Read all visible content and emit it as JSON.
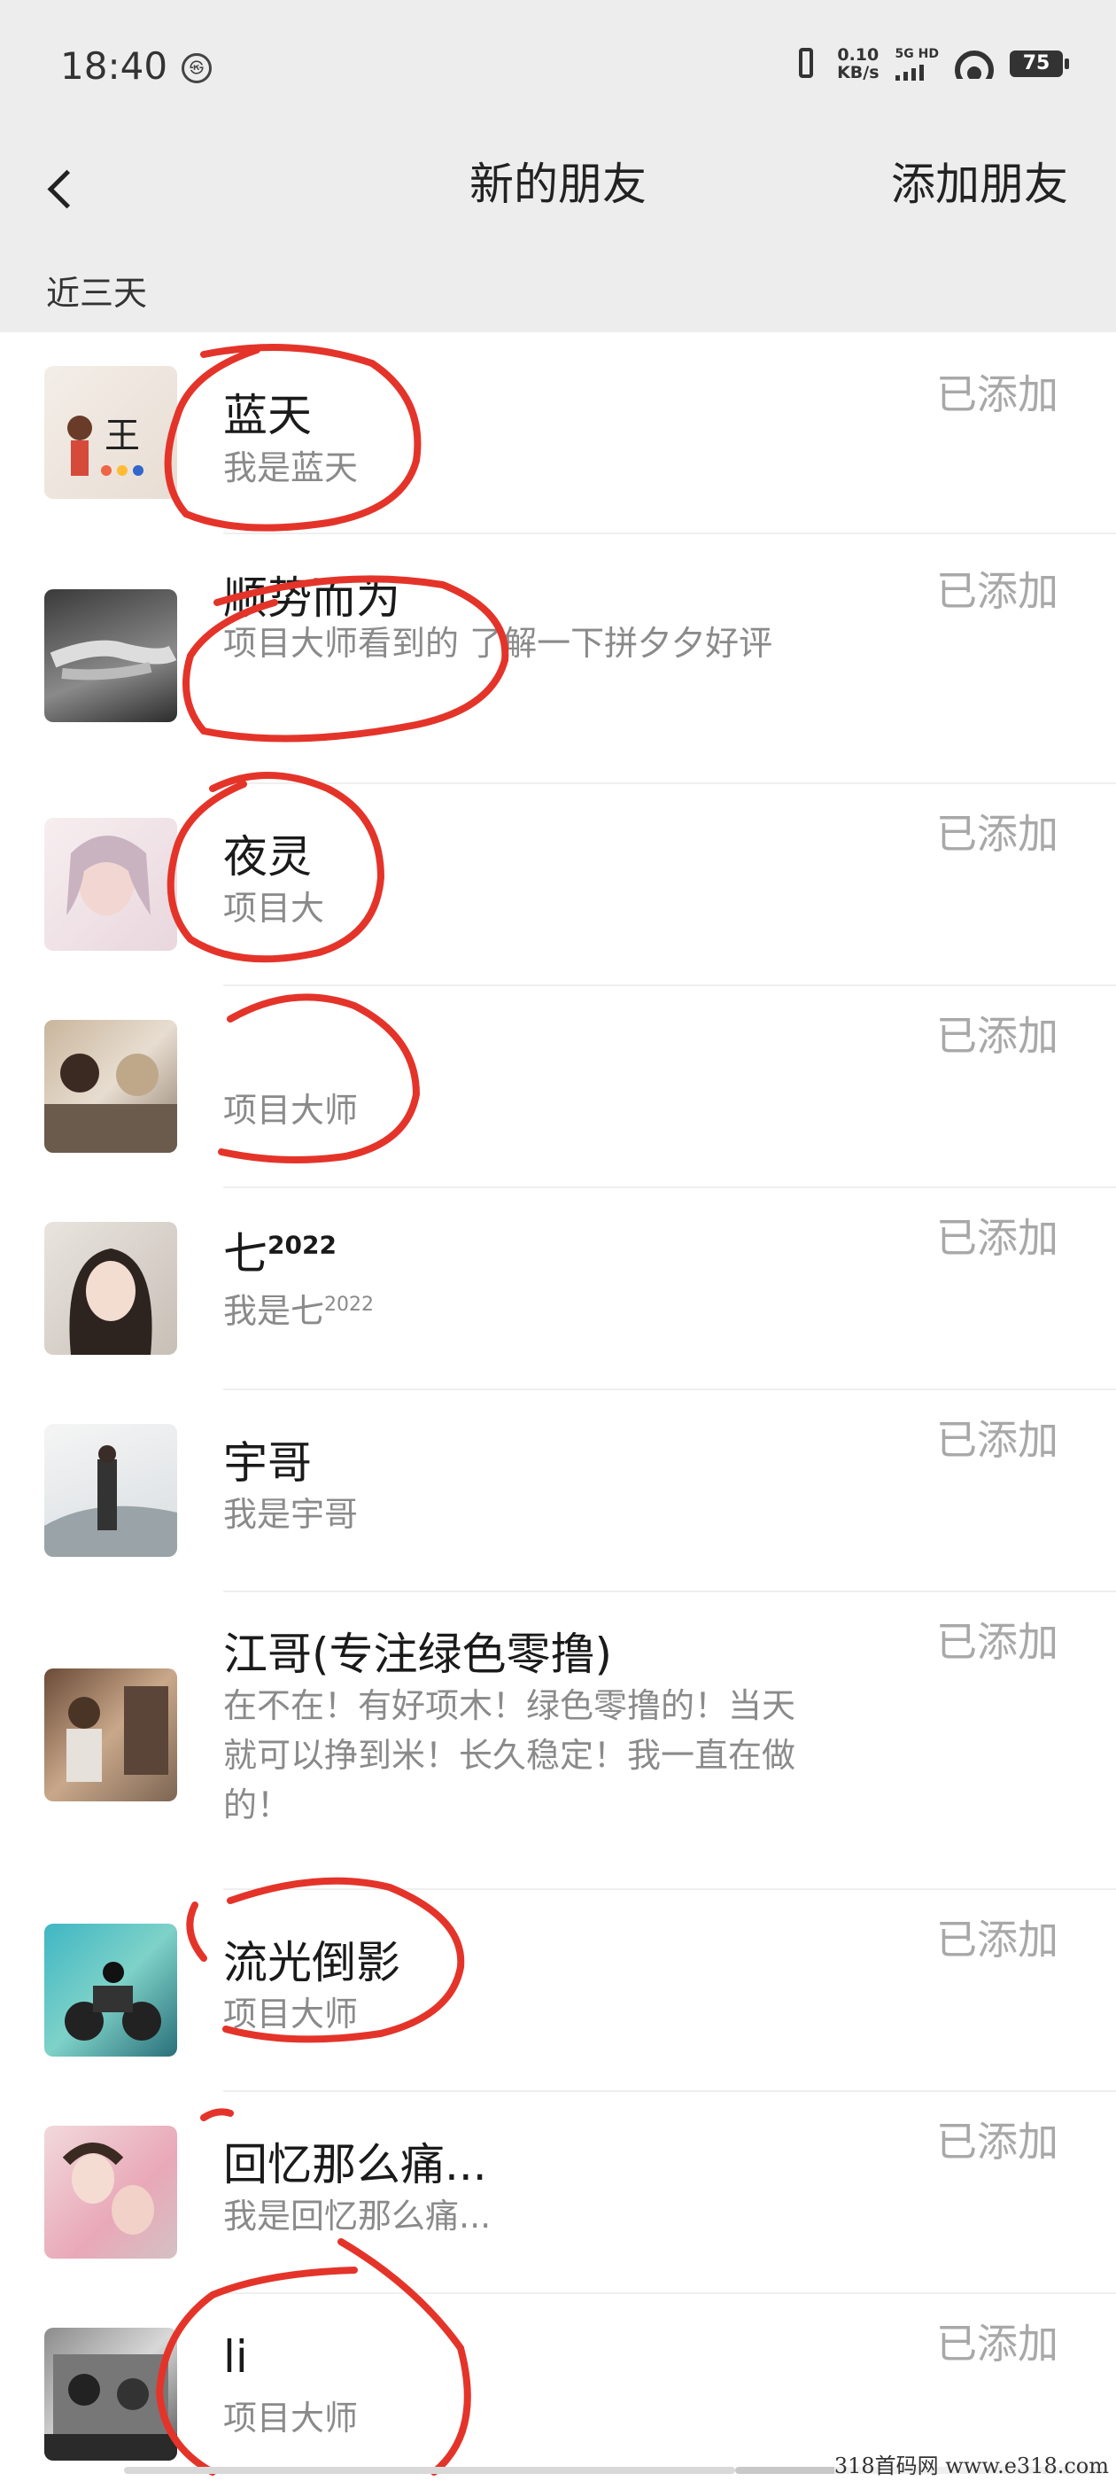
{
  "status_bar": {
    "time": "18:40",
    "hd_icon_text": "㉿",
    "net_speed_value": "0.10",
    "net_speed_unit": "KB/s",
    "signal_label": "5G HD",
    "battery": "75"
  },
  "header": {
    "title": "新的朋友",
    "add_label": "添加朋友"
  },
  "section": {
    "label": "近三天"
  },
  "friends": [
    {
      "name": "蓝天",
      "name_sup": "",
      "message": "我是蓝天",
      "message_sup": "",
      "status": "已添加"
    },
    {
      "name": "顺势而为",
      "name_sup": "",
      "message": "项目大师看到的   了解一下拼夕夕好评",
      "message_sup": "",
      "status": "已添加"
    },
    {
      "name": "夜灵",
      "name_sup": "",
      "message": "项目大",
      "message_sup": "",
      "status": "已添加"
    },
    {
      "name": "",
      "name_sup": "",
      "message": "项目大师",
      "message_sup": "",
      "status": "已添加"
    },
    {
      "name": "七",
      "name_sup": "2022",
      "message": "我是七",
      "message_sup": "2022",
      "status": "已添加"
    },
    {
      "name": "宇哥",
      "name_sup": "",
      "message": "我是宇哥",
      "message_sup": "",
      "status": "已添加"
    },
    {
      "name": "江哥(专注绿色零撸)",
      "name_sup": "",
      "message": "在不在！有好项木！绿色零撸的！当天就可以挣到米！长久稳定！我一直在做的！",
      "message_sup": "",
      "status": "已添加"
    },
    {
      "name": "流光倒影",
      "name_sup": "",
      "message": "项目大师",
      "message_sup": "",
      "status": "已添加"
    },
    {
      "name": "回忆那么痛...",
      "name_sup": "",
      "message": "我是回忆那么痛...",
      "message_sup": "",
      "status": "已添加"
    },
    {
      "name": "li",
      "name_sup": "",
      "message": "项目大师",
      "message_sup": "",
      "status": "已添加"
    }
  ],
  "watermark": "318首码网  www.e318.com",
  "colors": {
    "header_bg": "#ededed",
    "annotation_red": "#e4342a",
    "status_gray": "#a8a8a8"
  }
}
